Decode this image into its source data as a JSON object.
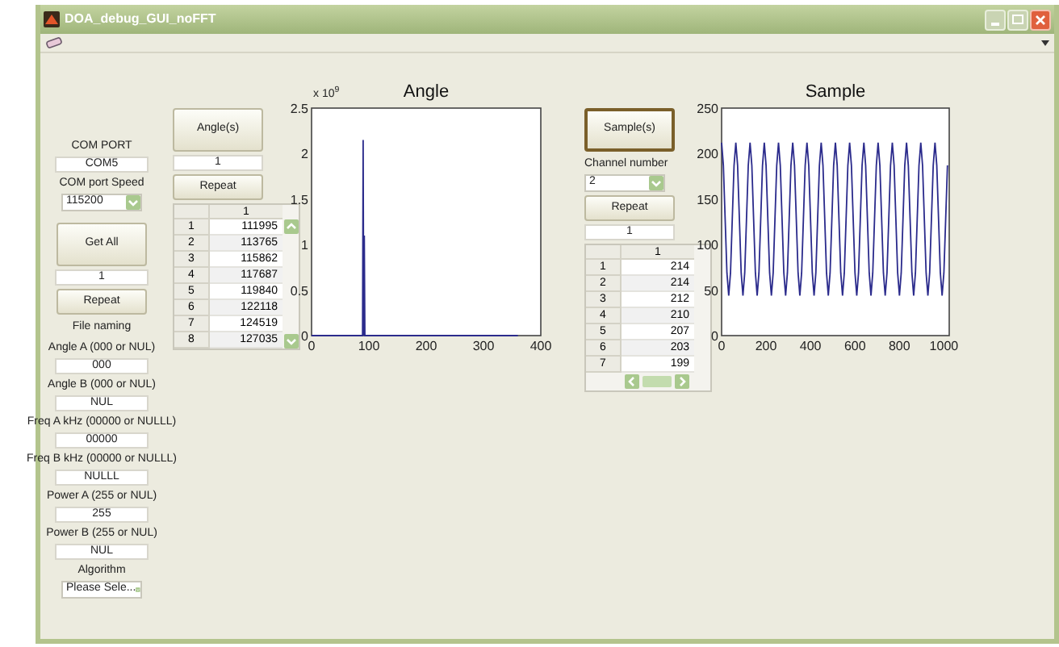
{
  "window": {
    "title": "DOA_debug_GUI_noFFT"
  },
  "left_panel": {
    "items": [
      {
        "kind": "label",
        "text": "COM PORT"
      },
      {
        "kind": "field",
        "value": "COM5"
      },
      {
        "kind": "label",
        "text": "COM port Speed"
      },
      {
        "kind": "select",
        "value": "115200"
      },
      {
        "kind": "big_button",
        "label": "Get All",
        "focused": false
      },
      {
        "kind": "field",
        "value": "1"
      },
      {
        "kind": "button",
        "label": "Repeat",
        "focused": false
      },
      {
        "kind": "label",
        "text": "File naming"
      },
      {
        "kind": "label",
        "text": "Angle A (000 or NUL)"
      },
      {
        "kind": "field",
        "value": "000"
      },
      {
        "kind": "label",
        "text": "Angle B (000 or NUL)"
      },
      {
        "kind": "field",
        "value": "NUL"
      },
      {
        "kind": "label",
        "text": "Freq A kHz (00000 or NULLL)"
      },
      {
        "kind": "field",
        "value": "00000"
      },
      {
        "kind": "label",
        "text": "Freq B kHz (00000 or NULLL)"
      },
      {
        "kind": "field",
        "value": "NULLL"
      },
      {
        "kind": "label",
        "text": "Power A (255 or NUL)"
      },
      {
        "kind": "field",
        "value": "255"
      },
      {
        "kind": "label",
        "text": "Power B (255 or NUL)"
      },
      {
        "kind": "field",
        "value": "NUL"
      },
      {
        "kind": "label",
        "text": "Algorithm"
      },
      {
        "kind": "select",
        "value": "Please Sele..."
      }
    ]
  },
  "angle_panel": {
    "items": [
      {
        "kind": "big_button",
        "label": "Angle(s)",
        "focused": false
      },
      {
        "kind": "field",
        "value": "1"
      },
      {
        "kind": "button",
        "label": "Repeat",
        "focused": false
      }
    ],
    "table": {
      "columns": [
        "1"
      ],
      "rows": [
        {
          "index": "1",
          "value": "111995"
        },
        {
          "index": "2",
          "value": "113765"
        },
        {
          "index": "3",
          "value": "115862"
        },
        {
          "index": "4",
          "value": "117687"
        },
        {
          "index": "5",
          "value": "119840"
        },
        {
          "index": "6",
          "value": "122118"
        },
        {
          "index": "7",
          "value": "124519"
        },
        {
          "index": "8",
          "value": "127035"
        }
      ]
    },
    "chart_data": {
      "type": "line",
      "title": "Angle",
      "xlim": [
        0,
        400
      ],
      "ylim": [
        0,
        2.5
      ],
      "xticks": [
        0,
        100,
        200,
        300,
        400
      ],
      "yticks": [
        0,
        0.5,
        1,
        1.5,
        2,
        2.5
      ],
      "annotations": [
        "x 10$^{9}$"
      ],
      "x": [
        0,
        89,
        90,
        91,
        92,
        93,
        360
      ],
      "series": [
        {
          "color": "#2b2b8c",
          "values": [
            0,
            0,
            2.15,
            0,
            1.1,
            0,
            0
          ]
        }
      ]
    }
  },
  "sample_panel": {
    "items": [
      {
        "kind": "big_button",
        "label": "Sample(s)",
        "focused": true
      },
      {
        "kind": "label",
        "text": "Channel number"
      },
      {
        "kind": "select",
        "value": "2"
      },
      {
        "kind": "button",
        "label": "Repeat",
        "focused": false
      },
      {
        "kind": "field",
        "value": "1"
      }
    ],
    "table": {
      "columns": [
        "1"
      ],
      "rows": [
        {
          "index": "1",
          "value": "214"
        },
        {
          "index": "2",
          "value": "214"
        },
        {
          "index": "3",
          "value": "212"
        },
        {
          "index": "4",
          "value": "210"
        },
        {
          "index": "5",
          "value": "207"
        },
        {
          "index": "6",
          "value": "203"
        },
        {
          "index": "7",
          "value": "199"
        }
      ]
    },
    "chart_data": {
      "type": "line",
      "title": "Sample",
      "xlim": [
        0,
        1024
      ],
      "ylim": [
        0,
        250
      ],
      "xticks": [
        0,
        200,
        400,
        600,
        800,
        1000
      ],
      "yticks": [
        0,
        50,
        100,
        150,
        200,
        250
      ],
      "x": [
        0,
        8,
        16,
        24,
        32,
        40,
        48,
        56,
        64,
        72,
        80,
        88,
        96,
        104,
        112,
        120,
        128,
        136,
        144,
        152,
        160,
        168,
        176,
        184,
        192,
        200,
        208,
        216,
        224,
        232,
        240,
        248,
        256,
        264,
        272,
        280,
        288,
        296,
        304,
        312,
        320,
        328,
        336,
        344,
        352,
        360,
        368,
        376,
        384,
        392,
        400,
        408,
        416,
        424,
        432,
        440,
        448,
        456,
        464,
        472,
        480,
        488,
        496,
        504,
        512,
        520,
        528,
        536,
        544,
        552,
        560,
        568,
        576,
        584,
        592,
        600,
        608,
        616,
        624,
        632,
        640,
        648,
        656,
        664,
        672,
        680,
        688,
        696,
        704,
        712,
        720,
        728,
        736,
        744,
        752,
        760,
        768,
        776,
        784,
        792,
        800,
        808,
        816,
        824,
        832,
        840,
        848,
        856,
        864,
        872,
        880,
        888,
        896,
        904,
        912,
        920,
        928,
        936,
        944,
        952,
        960,
        968,
        976,
        984,
        992,
        1000,
        1008,
        1016
      ],
      "series": [
        {
          "color": "#2b2b8c",
          "values": [
            212,
            187,
            128,
            69,
            44,
            69,
            128,
            187,
            212,
            187,
            128,
            69,
            44,
            69,
            128,
            187,
            212,
            187,
            128,
            69,
            44,
            69,
            128,
            187,
            212,
            187,
            128,
            69,
            44,
            69,
            128,
            187,
            212,
            187,
            128,
            69,
            44,
            69,
            128,
            187,
            212,
            187,
            128,
            69,
            44,
            69,
            128,
            187,
            212,
            187,
            128,
            69,
            44,
            69,
            128,
            187,
            212,
            187,
            128,
            69,
            44,
            69,
            128,
            187,
            212,
            187,
            128,
            69,
            44,
            69,
            128,
            187,
            212,
            187,
            128,
            69,
            44,
            69,
            128,
            187,
            212,
            187,
            128,
            69,
            44,
            69,
            128,
            187,
            212,
            187,
            128,
            69,
            44,
            69,
            128,
            187,
            212,
            187,
            128,
            69,
            44,
            69,
            128,
            187,
            212,
            187,
            128,
            69,
            44,
            69,
            128,
            187,
            212,
            187,
            128,
            69,
            44,
            69,
            128,
            187,
            212,
            187,
            128,
            69,
            44,
            69,
            128,
            187
          ]
        }
      ]
    }
  }
}
